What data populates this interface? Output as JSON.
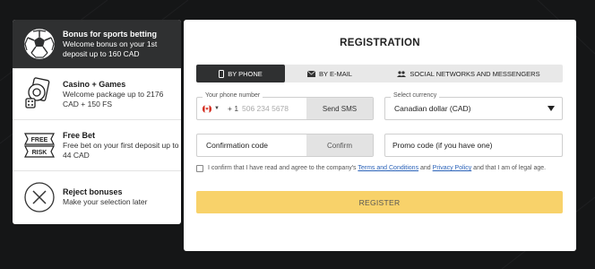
{
  "bonuses": [
    {
      "title": "Bonus for sports betting",
      "desc": "Welcome bonus on your 1st deposit up to 160 CAD",
      "icon": "soccer-ball-icon",
      "active": true
    },
    {
      "title": "Casino + Games",
      "desc": "Welcome package up to 2176 CAD + 150 FS",
      "icon": "casino-cards-icon",
      "active": false
    },
    {
      "title": "Free Bet",
      "desc": "Free bet on your first deposit up to 44 CAD",
      "icon": "free-risk-ticket-icon",
      "active": false
    },
    {
      "title": "Reject bonuses",
      "desc": "Make your selection later",
      "icon": "close-circle-icon",
      "active": false
    }
  ],
  "registration": {
    "title": "REGISTRATION",
    "tabs": [
      {
        "label": "BY PHONE",
        "icon": "phone-icon",
        "active": true
      },
      {
        "label": "BY E-MAIL",
        "icon": "envelope-icon",
        "active": false
      },
      {
        "label": "SOCIAL NETWORKS AND MESSENGERS",
        "icon": "people-icon",
        "active": false
      }
    ],
    "phone": {
      "label": "Your phone number",
      "flag": "canada-flag-icon",
      "country_code": "+ 1",
      "placeholder": "506 234 5678",
      "sms_button": "Send SMS"
    },
    "currency": {
      "label": "Select currency",
      "value": "Canadian dollar (CAD)"
    },
    "confirmation": {
      "label": "Confirmation code",
      "button": "Confirm"
    },
    "promo": {
      "placeholder": "Promo code (if you have one)"
    },
    "agreement": {
      "text_before": "I confirm that I have read and agree to the company's ",
      "terms_link": "Terms and Conditions",
      "text_middle": " and ",
      "privacy_link": "Privacy Policy",
      "text_after": " and that I am of legal age."
    },
    "register_button": "REGISTER"
  },
  "colors": {
    "background": "#151617",
    "active_dark": "#2f3031",
    "register_yellow": "#f8d26a",
    "link_blue": "#2a62b8"
  }
}
